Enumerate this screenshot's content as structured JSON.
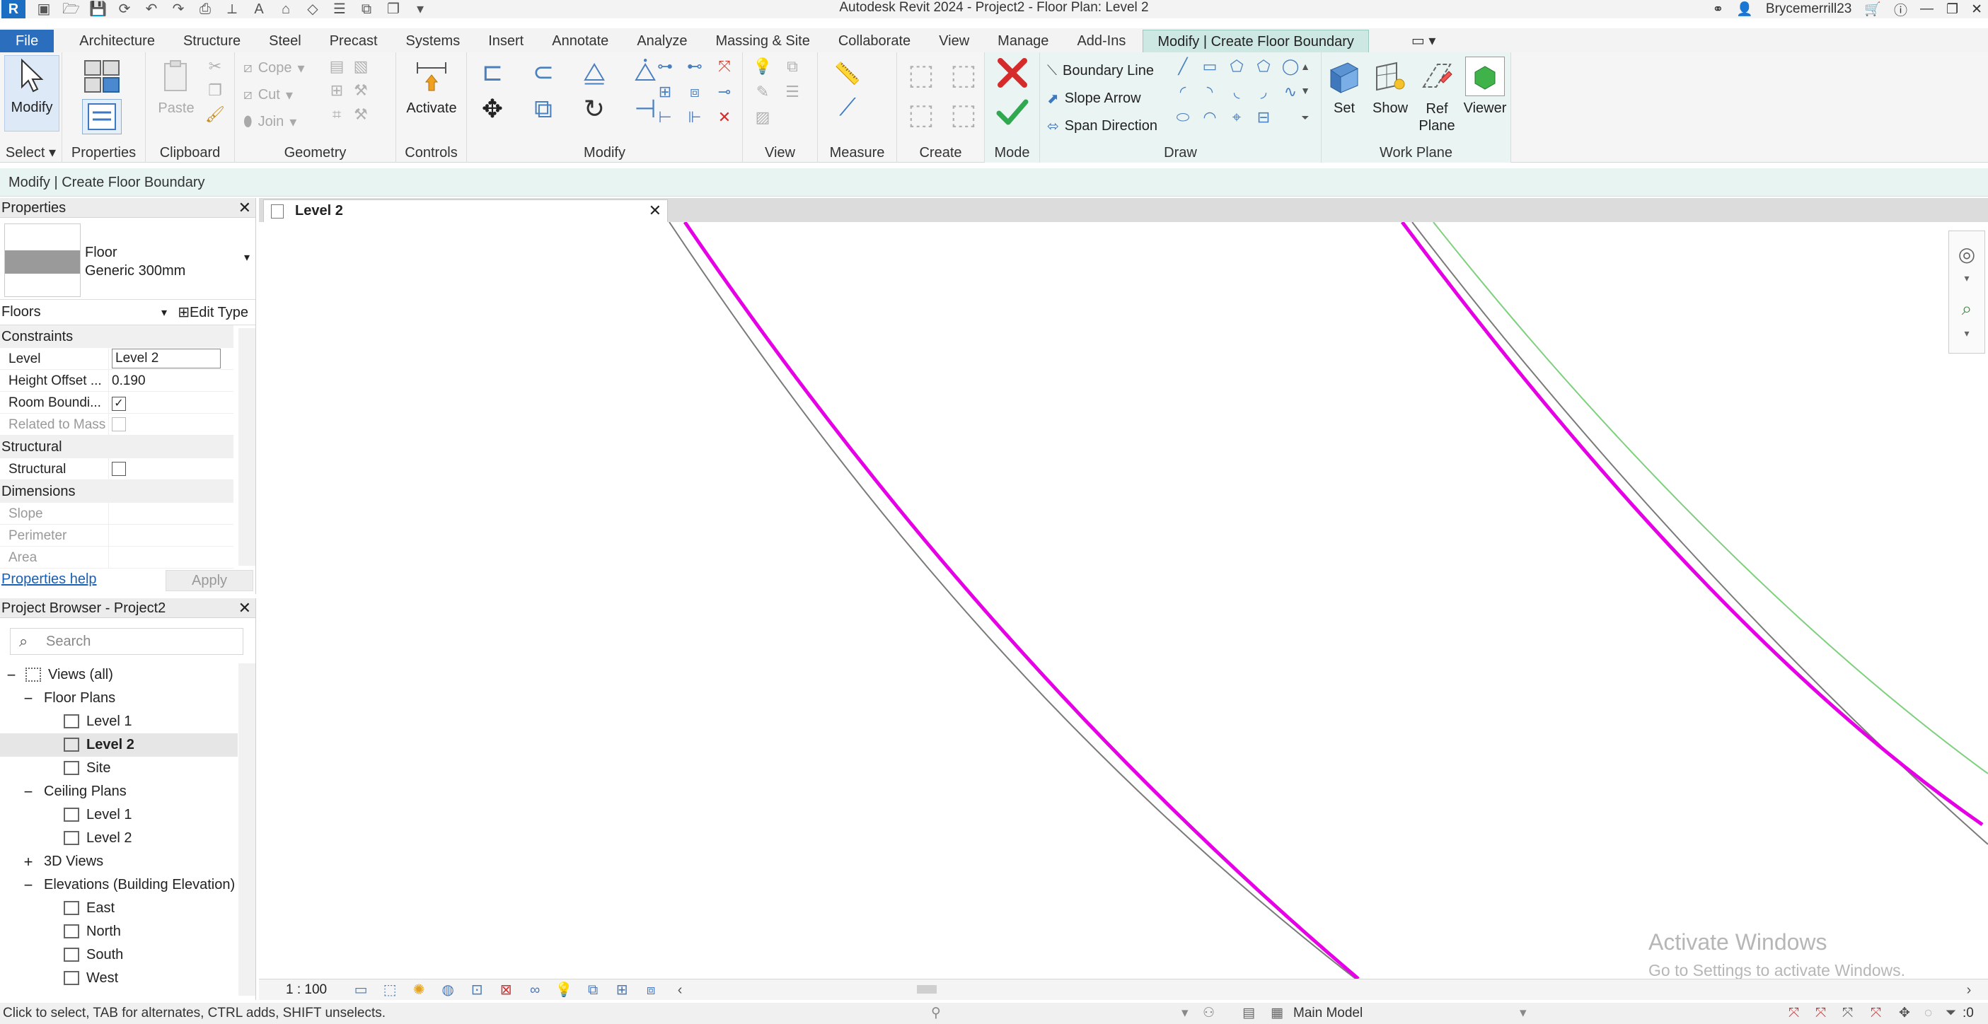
{
  "window": {
    "title": "Autodesk Revit 2024 - Project2 - Floor Plan: Level 2",
    "user": "Brycemerrill23",
    "logo_letter": "R"
  },
  "tabs": [
    {
      "label": "File"
    },
    {
      "label": "Architecture"
    },
    {
      "label": "Structure"
    },
    {
      "label": "Steel"
    },
    {
      "label": "Precast"
    },
    {
      "label": "Systems"
    },
    {
      "label": "Insert"
    },
    {
      "label": "Annotate"
    },
    {
      "label": "Analyze"
    },
    {
      "label": "Massing & Site"
    },
    {
      "label": "Collaborate"
    },
    {
      "label": "View"
    },
    {
      "label": "Manage"
    },
    {
      "label": "Add-Ins"
    },
    {
      "label": "Modify | Create Floor Boundary"
    }
  ],
  "ribbon": {
    "modify_label": "Modify",
    "select_label": "Select",
    "properties_label": "Properties",
    "clipboard": {
      "label": "Clipboard",
      "paste": "Paste"
    },
    "geometry": {
      "label": "Geometry",
      "cope": "Cope",
      "cut": "Cut",
      "join": "Join"
    },
    "controls": {
      "label": "Controls",
      "activate": "Activate"
    },
    "modify_panel": {
      "label": "Modify"
    },
    "view": {
      "label": "View"
    },
    "measure": {
      "label": "Measure"
    },
    "create": {
      "label": "Create"
    },
    "mode": {
      "label": "Mode"
    },
    "draw": {
      "label": "Draw",
      "boundary_line": "Boundary Line",
      "slope_arrow": "Slope Arrow",
      "span_direction": "Span Direction"
    },
    "workplane": {
      "label": "Work Plane",
      "set": "Set",
      "show": "Show",
      "ref": "Ref",
      "plane": "Plane",
      "viewer": "Viewer"
    }
  },
  "optionbar": {
    "text": "Modify | Create Floor Boundary"
  },
  "properties": {
    "title": "Properties",
    "type_family": "Floor",
    "type_name": "Generic 300mm",
    "filter": "Floors",
    "edit_type": "Edit Type",
    "groups": {
      "constraints": "Constraints",
      "structural": "Structural",
      "dimensions": "Dimensions"
    },
    "rows": {
      "level_k": "Level",
      "level_v": "Level 2",
      "height_k": "Height Offset ...",
      "height_v": "0.190",
      "room_k": "Room Boundi...",
      "related_k": "Related to Mass",
      "structural_k": "Structural",
      "slope_k": "Slope",
      "perimeter_k": "Perimeter",
      "area_k": "Area"
    },
    "checks": {
      "room_bounding": true,
      "related_to_mass": false,
      "structural": false
    },
    "help": "Properties help",
    "apply": "Apply"
  },
  "browser": {
    "title": "Project Browser - Project2",
    "search_placeholder": "Search",
    "tree": {
      "views_all": "Views (all)",
      "floor_plans": "Floor Plans",
      "fp_level1": "Level 1",
      "fp_level2": "Level 2",
      "fp_site": "Site",
      "ceiling_plans": "Ceiling Plans",
      "cp_level1": "Level 1",
      "cp_level2": "Level 2",
      "views_3d": "3D Views",
      "elevations": "Elevations (Building Elevation)",
      "east": "East",
      "north": "North",
      "south": "South",
      "west": "West"
    }
  },
  "view": {
    "tab_label": "Level 2",
    "scale": "1 : 100",
    "watermark_title": "Activate Windows",
    "watermark_sub": "Go to Settings to activate Windows."
  },
  "status": {
    "hint": "Click to select, TAB for alternates, CTRL adds, SHIFT unselects.",
    "model": "Main Model",
    "filter_count": ":0"
  },
  "colors": {
    "sketch_line": "#e600e6",
    "file_tab": "#2a6ebd",
    "context_tab": "#cde8e3",
    "cancel": "#d62b2b",
    "finish": "#2fa84f"
  }
}
